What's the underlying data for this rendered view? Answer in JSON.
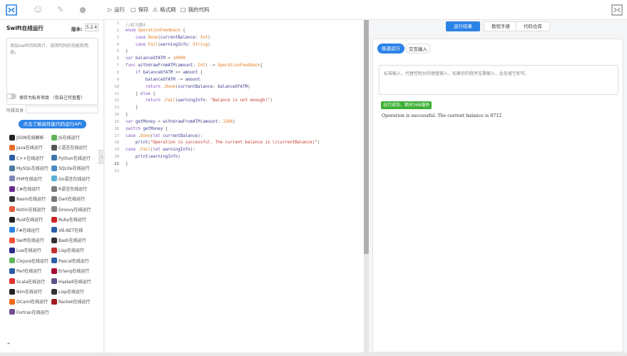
{
  "toolbar": {
    "run_label": "运行",
    "save_label": "保存",
    "format_label": "格式刷",
    "my_code_label": "我的代码"
  },
  "sidebar": {
    "title": "Swift在线运行",
    "version_label": "版本:",
    "version_value": "5.2.4",
    "description_placeholder": "添加swift代码简介，说明代码的功能和用途。",
    "private_label": "保存为私有项目 （仅自己可查看）",
    "dir_label": "所属目录",
    "api_button": "点击了解高性能代码运行API",
    "languages": [
      {
        "label": "JSON在线解析",
        "icon": "json-icon",
        "color": "#222222"
      },
      {
        "label": "JS在线运行",
        "icon": "js-icon",
        "color": "#5fb55a"
      },
      {
        "label": "Java在线运行",
        "icon": "java-icon",
        "color": "#e46c2b"
      },
      {
        "label": "C语言在线运行",
        "icon": "c-icon",
        "color": "#555555"
      },
      {
        "label": "C++在线运行",
        "icon": "cpp-icon",
        "color": "#2b5ea8"
      },
      {
        "label": "Python在线运行",
        "icon": "python-icon",
        "color": "#3c75a8"
      },
      {
        "label": "MySQL在线运行",
        "icon": "mysql-icon",
        "color": "#4b7aa0"
      },
      {
        "label": "SQLite在线运行",
        "icon": "sqlite-icon",
        "color": "#4a8bc8"
      },
      {
        "label": "PHP在线运行",
        "icon": "php-icon",
        "color": "#7a86b8"
      },
      {
        "label": "Go语言在线运行",
        "icon": "go-icon",
        "color": "#5ab0d6"
      },
      {
        "label": "C#在线运行",
        "icon": "csharp-icon",
        "color": "#6a2d91"
      },
      {
        "label": "R语言在线运行",
        "icon": "r-icon",
        "color": "#7a7a7a"
      },
      {
        "label": "Nasm在线运行",
        "icon": "nasm-icon",
        "color": "#333333"
      },
      {
        "label": "Dart在线运行",
        "icon": "dart-icon",
        "color": "#777777"
      },
      {
        "label": "Kotlin在线运行",
        "icon": "kotlin-icon",
        "color": "#e45c3a"
      },
      {
        "label": "Groovy在线运行",
        "icon": "groovy-icon",
        "color": "#888888"
      },
      {
        "label": "Rust在线运行",
        "icon": "rust-icon",
        "color": "#222222"
      },
      {
        "label": "Ruby在线运行",
        "icon": "ruby-icon",
        "color": "#cc2222"
      },
      {
        "label": "F#在线运行",
        "icon": "fsharp-icon",
        "color": "#2c83e6"
      },
      {
        "label": "VB.NET在线",
        "icon": "vbnet-icon",
        "color": "#2b5ea8"
      },
      {
        "label": "Swift在线运行",
        "icon": "swift-icon",
        "color": "#f05138"
      },
      {
        "label": "Bash在线运行",
        "icon": "bash-icon",
        "color": "#333333"
      },
      {
        "label": "Lua在线运行",
        "icon": "lua-icon",
        "color": "#2b2b88"
      },
      {
        "label": "Lisp在线运行",
        "icon": "lisp-icon",
        "color": "#c03030"
      },
      {
        "label": "Clojure在线运行",
        "icon": "clojure-icon",
        "color": "#5fb55a"
      },
      {
        "label": "Pascal在线运行",
        "icon": "pascal-icon",
        "color": "#2b5ea8"
      },
      {
        "label": "Perl在线运行",
        "icon": "perl-icon",
        "color": "#2b5ea8"
      },
      {
        "label": "Erlang在线运行",
        "icon": "erlang-icon",
        "color": "#a90533"
      },
      {
        "label": "Scala在线运行",
        "icon": "scala-icon",
        "color": "#dc322f"
      },
      {
        "label": "Haskell在线运行",
        "icon": "haskell-icon",
        "color": "#5e5086"
      },
      {
        "label": "Nim在线运行",
        "icon": "nim-icon",
        "color": "#222222"
      },
      {
        "label": "Lisp在线运行",
        "icon": "lisp-icon",
        "color": "#333333"
      },
      {
        "label": "OCaml在线运行",
        "icon": "ocaml-icon",
        "color": "#ee6a1a"
      },
      {
        "label": "Racket在线运行",
        "icon": "racket-icon",
        "color": "#9f1d20"
      },
      {
        "label": "Fortran在线运行",
        "icon": "fortran-icon",
        "color": "#734f96"
      }
    ]
  },
  "editor": {
    "lines": [
      "//练习题4",
      "enum OperationFeedback {",
      "    case Done(currentBalance: Int)",
      "    case Fail(warningInfo: String)",
      "}",
      "var balanceOfATM = 10000",
      "func withdrawFromATM(amount: Int) -> OperationFeedback{",
      "    if balanceOfATM >= amount {",
      "        balanceOfATM -= amount",
      "        return .Done(currentBalance: balanceOfATM)",
      "    } else {",
      "        return .Fail(warningInfo: \"Balance is not enough!\")",
      "    }",
      "}",
      "var getMoney = withdrawFromATM(amount: 1288)",
      "switch getMoney {",
      "case .Done(let currentBalance):",
      "    print(\"Operation is successful. The current balance is \\(currentBalance)\")",
      "case .Fail(let warningInfo):",
      "    print(warningInfo)",
      "}",
      ""
    ],
    "active_line": 21
  },
  "right": {
    "tabs": [
      "运行结果",
      "教程手册",
      "代码仓库"
    ],
    "subtabs": [
      "极速运行",
      "交互输入"
    ],
    "stdin_placeholder": "标准输入，代替控制台的键盘输入，如果你的程序无需输入，此处留空即可。",
    "status": "运行成功，耗时368毫秒",
    "output": "Operation is successful. The current balance is 8712"
  },
  "colors": {
    "accent": "#2c83e6",
    "success": "#3cb034",
    "keyword": "#7a4dbf",
    "type": "#e07a1a",
    "number": "#e07a1a",
    "string": "#c0392b",
    "comment": "#999999"
  }
}
